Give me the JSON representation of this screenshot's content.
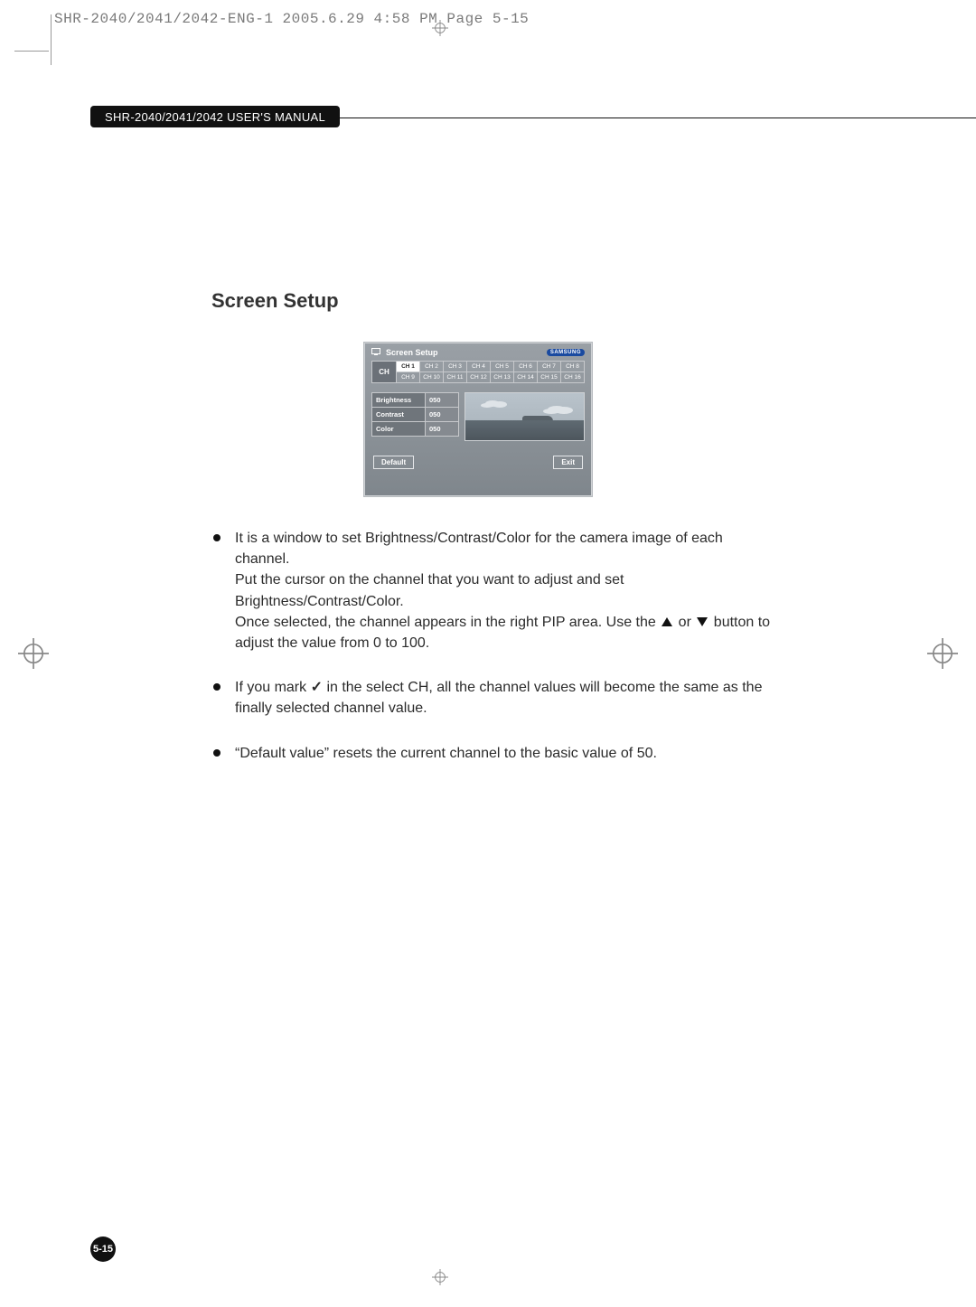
{
  "meta_header": "SHR-2040/2041/2042-ENG-1  2005.6.29  4:58 PM  Page 5-15",
  "manual_label": "SHR-2040/2041/2042 USER'S MANUAL",
  "section_title": "Screen Setup",
  "osd": {
    "title": "Screen Setup",
    "logo": "SAMSUNG",
    "ch_label": "CH",
    "channels_row1": [
      "CH 1",
      "CH 2",
      "CH 3",
      "CH 4",
      "CH 5",
      "CH 6",
      "CH 7",
      "CH 8"
    ],
    "channels_row2": [
      "CH 9",
      "CH 10",
      "CH 11",
      "CH 12",
      "CH 13",
      "CH 14",
      "CH 15",
      "CH 16"
    ],
    "selected_channel": "CH 1",
    "params": [
      {
        "k": "Brightness",
        "v": "050"
      },
      {
        "k": "Contrast",
        "v": "050"
      },
      {
        "k": "Color",
        "v": "050"
      }
    ],
    "btn_default": "Default",
    "btn_exit": "Exit"
  },
  "bullets": {
    "b1a": "It is a window to set Brightness/Contrast/Color for the camera image of each channel.",
    "b1b": "Put the cursor on the channel that you want to adjust and set Brightness/Contrast/Color.",
    "b1c_before": "Once selected, the channel appears in the right PIP area. Use the ",
    "b1c_mid": " or ",
    "b1c_after": " button to adjust the value from 0 to 100.",
    "b2_before": "If you mark ",
    "b2_after": " in the select CH, all the channel values will become the same as the finally selected channel value.",
    "b3": "“Default value” resets the current channel to the basic value of 50."
  },
  "page_number": "5-15"
}
